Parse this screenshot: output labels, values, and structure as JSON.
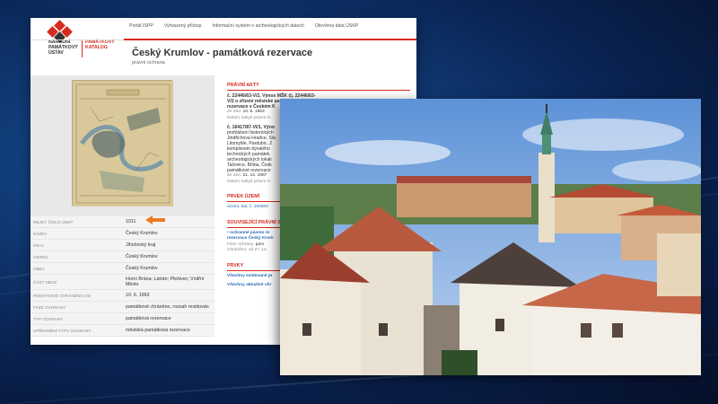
{
  "header": {
    "institution_name": "NÁRODNÍ PAMÁTKOVÝ ÚSTAV",
    "catalog_name": "PAMÁTKOVÝ KATALOG",
    "nav": [
      "Portál ISPP",
      "Vyhrazený přístup",
      "Informační systém o archeologických datech",
      "Otevřená data ÚSKP"
    ]
  },
  "page": {
    "title": "Český Krumlov - památková rezervace",
    "subtitle": "právní ochrana"
  },
  "attributes": [
    {
      "label": "Rejst. číslo ÚSKP",
      "value": "1011"
    },
    {
      "label": "Název",
      "value": "Český Krumlov"
    },
    {
      "label": "Kraj",
      "value": "Jihočeský kraj"
    },
    {
      "label": "Okres",
      "value": "Český Krumlov"
    },
    {
      "label": "Obec",
      "value": "Český Krumlov"
    },
    {
      "label": "Část obce",
      "value": "Horní Brána; Latrán; Plešivec; Vnitřní Město"
    },
    {
      "label": "Památkově chráněno od",
      "value": "10. 6. 1963"
    },
    {
      "label": "Fáze ochrany",
      "value": "památkově chráněno, rozsah revidován"
    },
    {
      "label": "Typ ochrany",
      "value": "památková rezervace"
    },
    {
      "label": "Upřesnění typu ochrany",
      "value": "městská památková rezervace"
    }
  ],
  "right": {
    "legal_head": "Právní akty",
    "act1": {
      "title": "č. 22446/63-V/2, Výnos MŠK čj. 22446/63-V/2 o zřízení městské památkové rezervace v Českém K",
      "date_label": "Ze dne:",
      "date_value": "10. 6. 1963",
      "validity": "Datum nabytí právní m"
    },
    "act2": {
      "lines": [
        "č. 16417/87-VI/1, Výno",
        "prohlášení historických",
        "Jindřichova Hradce, Sla",
        "Litomyšle, Pardubic, Z",
        "komplexem bývalého",
        "technických památek",
        "archeologických lokali",
        "Tašovice, Bílina, Česk",
        "památkové rezervace"
      ],
      "date_label": "Ze dne:",
      "date_value": "21. 12. 1987",
      "validity": "Datum nabytí právní m"
    },
    "territory_head": "Prvek území",
    "territory_text": "území, kat. č. 100008",
    "related_head": "Související právní st",
    "related_link": "• ochranné pásmo re",
    "related_link2": "rezervace Český Krum",
    "related_phase_label": "Fáze ochrany:",
    "related_phase_value": "pam",
    "related_protected": "Chráněno: od 27. 12.",
    "elements_head": "Prvky",
    "link1": "Všechny evidované pr",
    "link2": "Všechny aktuálně chr"
  },
  "colors": {
    "accent": "#d52b1e",
    "link": "#2a6bb5",
    "arrow": "#f07a20"
  }
}
